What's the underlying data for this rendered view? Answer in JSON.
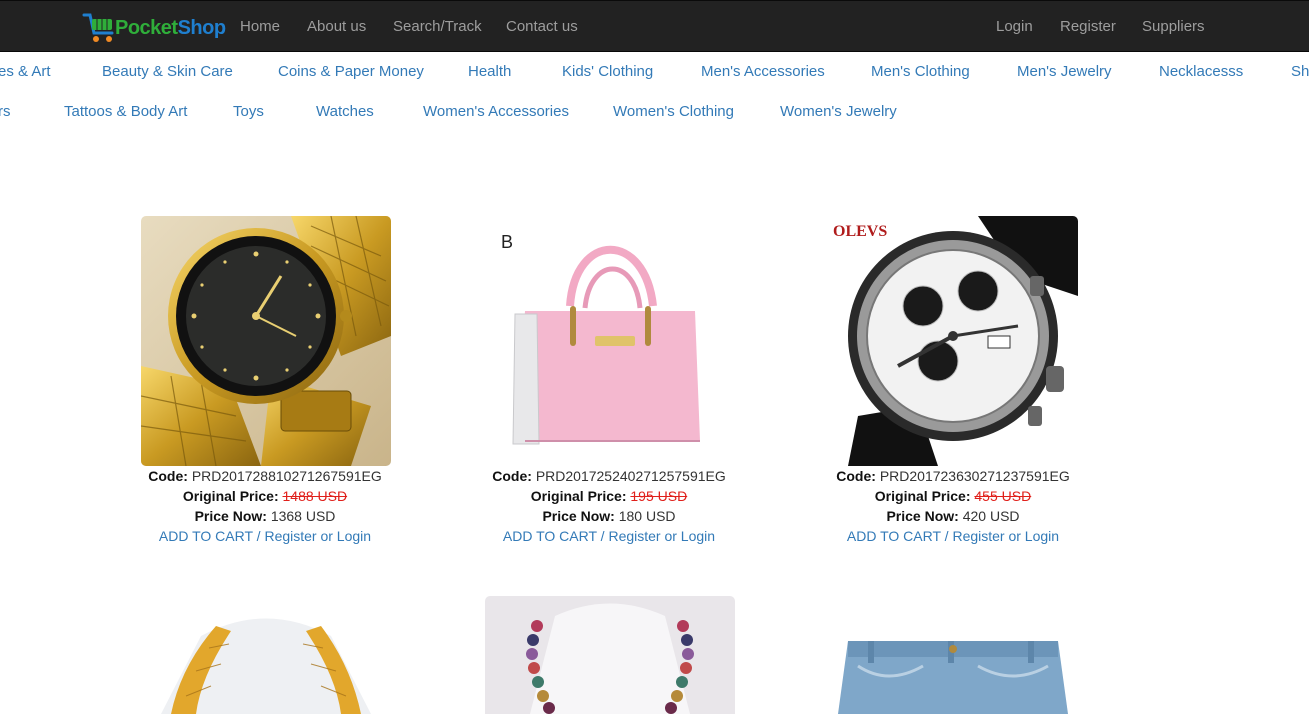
{
  "brand": {
    "name_part1": "Pocket",
    "name_part2": "Shop"
  },
  "nav": {
    "left": [
      "Home",
      "About us",
      "Search/Track",
      "Contact us"
    ],
    "right": [
      "Login",
      "Register",
      "Suppliers"
    ]
  },
  "categories": {
    "row1": [
      "es & Art",
      "Beauty & Skin Care",
      "Coins & Paper Money",
      "Health",
      "Kids' Clothing",
      "Men's Accessories",
      "Men's Clothing",
      "Men's Jewelry",
      "Necklacesss",
      "Sh"
    ],
    "row2": [
      "rs",
      "Tattoos & Body Art",
      "Toys",
      "Watches",
      "Women's Accessories",
      "Women's Clothing",
      "Women's Jewelry"
    ]
  },
  "labels": {
    "code": "Code:",
    "original_price": "Original Price:",
    "price_now": "Price Now:",
    "add_to_cart": "ADD TO CART / Register or Login"
  },
  "products": [
    {
      "code": "PRD201728810271267591EG",
      "original_price": "1488 USD",
      "price_now": "1368 USD",
      "image": "gold-watch-image"
    },
    {
      "code": "PRD201725240271257591EG",
      "original_price": "195 USD",
      "price_now": "180 USD",
      "image": "pink-handbag-image",
      "image_text": "B"
    },
    {
      "code": "PRD201723630271237591EG",
      "original_price": "455 USD",
      "price_now": "420 USD",
      "image": "chronograph-watch-image",
      "image_text": "OLEVS"
    },
    {
      "image": "gold-necklace-image"
    },
    {
      "image": "beaded-necklace-image"
    },
    {
      "image": "jeans-image"
    }
  ],
  "colors": {
    "navbar": "#222222",
    "link": "#337ab7",
    "strike": "#e0201b",
    "brand_green": "#2fae3a",
    "brand_blue": "#1f7fcf"
  }
}
